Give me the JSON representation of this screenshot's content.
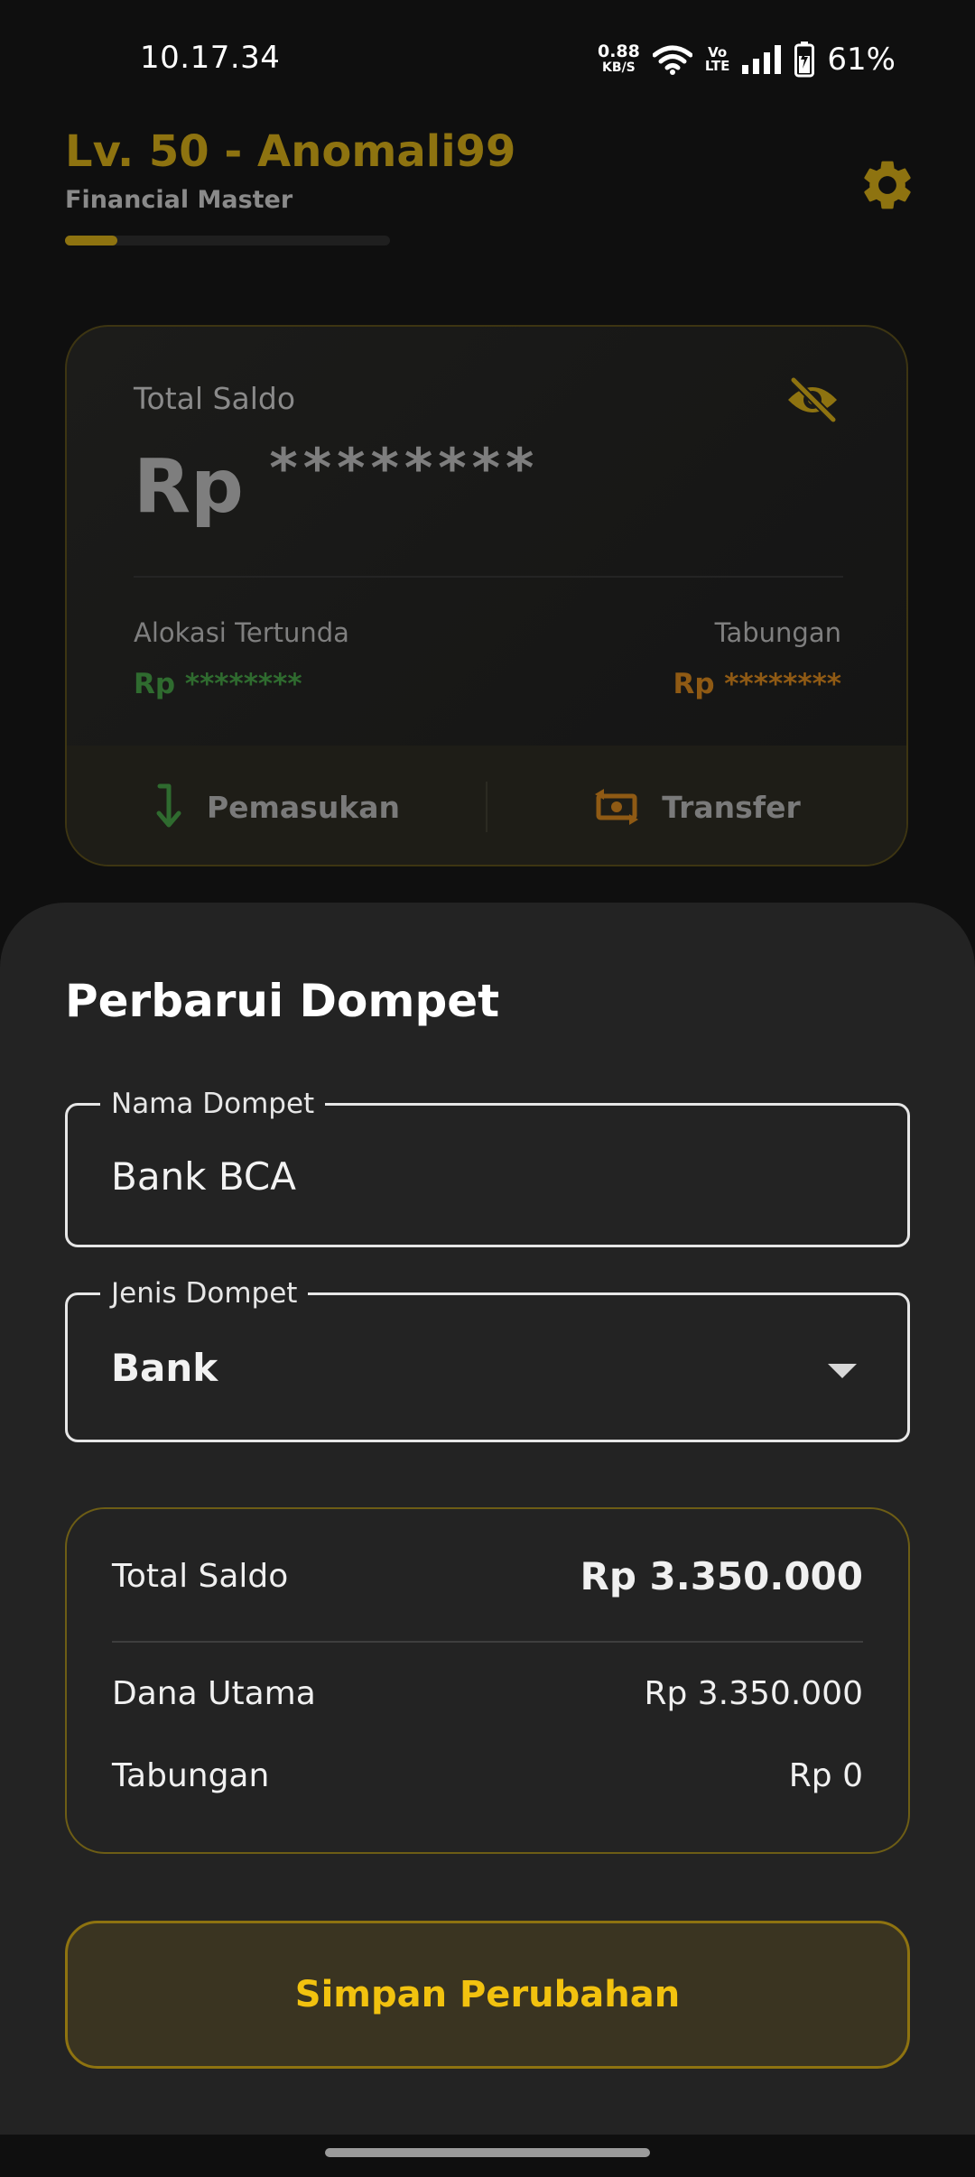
{
  "status_bar": {
    "time": "10.17.34",
    "net_speed": "0.88",
    "net_unit": "KB/S",
    "volte_top": "Vo",
    "volte_bottom": "LTE",
    "battery": "61%"
  },
  "header": {
    "level_title": "Lv. 50 - Anomali99",
    "rank": "Financial Master",
    "xp_progress": 0.16,
    "accent_color": "#8e7310"
  },
  "balance_card": {
    "label": "Total Saldo",
    "currency": "Rp",
    "hidden_amount": "********",
    "pending_label": "Alokasi Tertunda",
    "pending_value": "Rp ********",
    "savings_label": "Tabungan",
    "savings_value": "Rp ********",
    "income_label": "Pemasukan",
    "transfer_label": "Transfer"
  },
  "sheet": {
    "title": "Perbarui Dompet",
    "wallet_name_label": "Nama Dompet",
    "wallet_name_value": "Bank BCA",
    "wallet_type_label": "Jenis Dompet",
    "wallet_type_value": "Bank",
    "summary": {
      "total_label": "Total Saldo",
      "total_value": "Rp 3.350.000",
      "main_fund_label": "Dana Utama",
      "main_fund_value": "Rp 3.350.000",
      "savings_label": "Tabungan",
      "savings_value": "Rp 0"
    },
    "save_button": "Simpan Perubahan"
  }
}
